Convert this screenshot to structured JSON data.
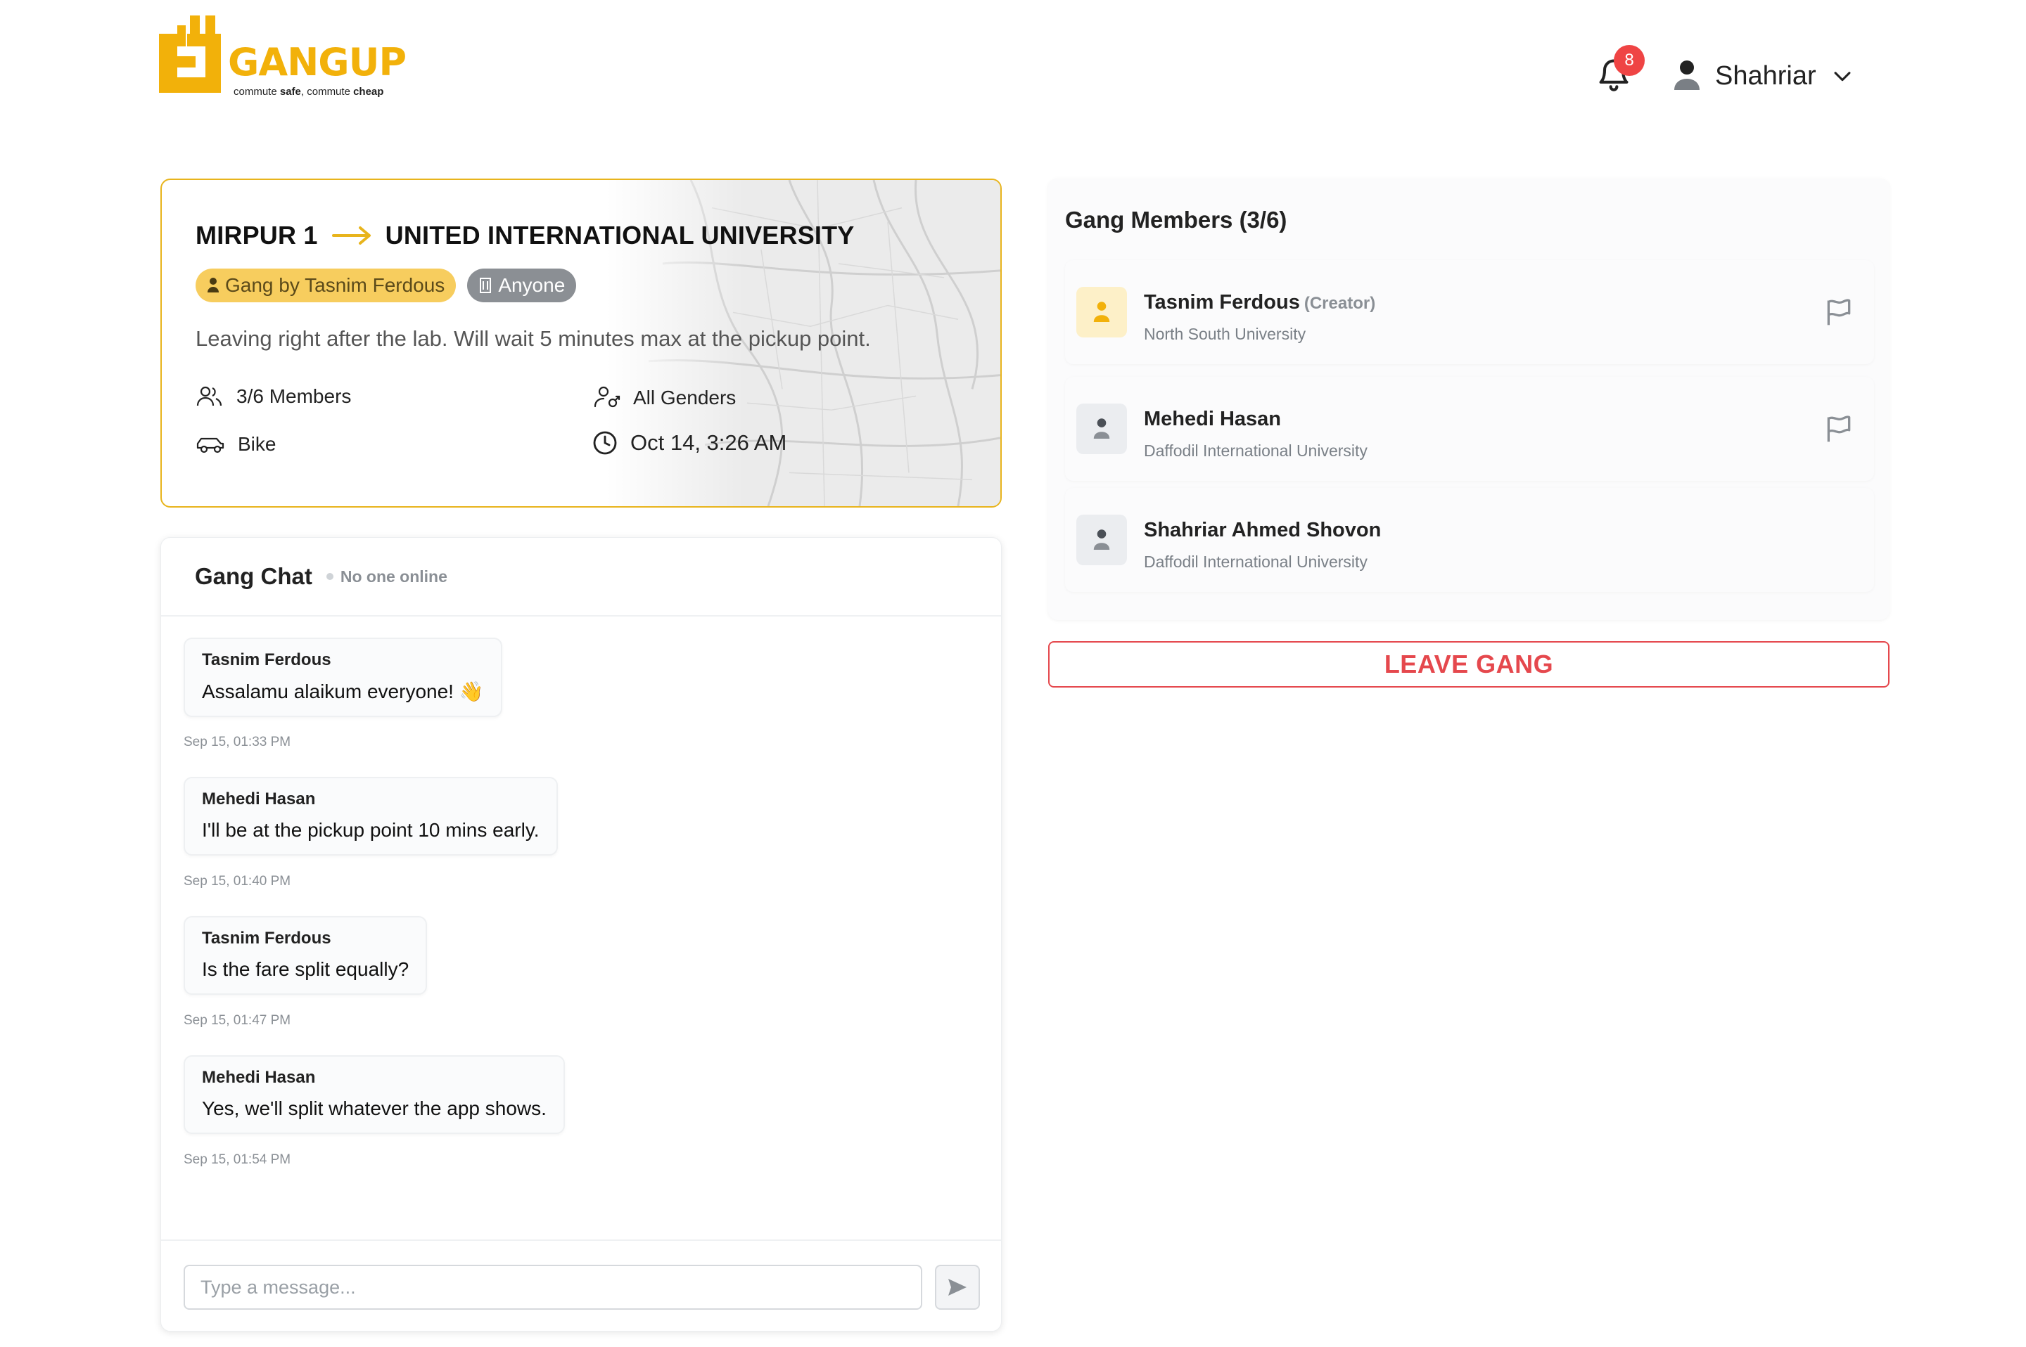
{
  "brand": {
    "name": "GANGUP",
    "tagline_prefix": "commute ",
    "tagline_b1": "safe",
    "tagline_mid": ", commute ",
    "tagline_b2": "cheap",
    "color": "#f2b10a"
  },
  "header": {
    "notification_count": "8",
    "user_name": "Shahriar"
  },
  "route": {
    "from": "MIRPUR 1",
    "to": "UNITED INTERNATIONAL UNIVERSITY",
    "creator_badge": "Gang by Tasnim Ferdous",
    "audience_badge": "Anyone",
    "note": "Leaving right after the lab. Will wait 5 minutes max at the pickup point.",
    "members": "3/6 Members",
    "genders": "All Genders",
    "vehicle": "Bike",
    "departure": "Oct 14, 3:26 AM",
    "accent": "#e8b41c"
  },
  "chat": {
    "title": "Gang Chat",
    "status": "No one online",
    "placeholder": "Type a message...",
    "messages": [
      {
        "sender": "Tasnim Ferdous",
        "text": "Assalamu alaikum everyone! 👋",
        "time": "Sep 15, 01:33 PM"
      },
      {
        "sender": "Mehedi Hasan",
        "text": "I'll be at the pickup point 10 mins early.",
        "time": "Sep 15, 01:40 PM"
      },
      {
        "sender": "Tasnim Ferdous",
        "text": "Is the fare split equally?",
        "time": "Sep 15, 01:47 PM"
      },
      {
        "sender": "Mehedi Hasan",
        "text": "Yes, we'll split whatever the app shows.",
        "time": "Sep 15, 01:54 PM"
      }
    ]
  },
  "members": {
    "title": "Gang Members (3/6)",
    "list": [
      {
        "name": "Tasnim Ferdous",
        "role": "(Creator)",
        "university": "North South University",
        "flag": true
      },
      {
        "name": "Mehedi Hasan",
        "role": "",
        "university": "Daffodil International University",
        "flag": true
      },
      {
        "name": "Shahriar Ahmed Shovon",
        "role": "",
        "university": "Daffodil International University",
        "flag": false
      }
    ]
  },
  "actions": {
    "leave_label": "LEAVE GANG",
    "danger_color": "#e5484d"
  }
}
